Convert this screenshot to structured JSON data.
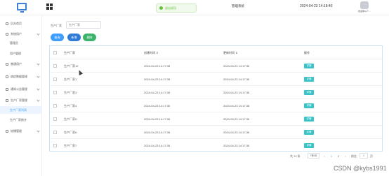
{
  "header": {
    "toast": "退出成功",
    "title": "管理系统",
    "datetime": "2024-04-23 14:18:40",
    "user_label": "欢迎你Cy⊤..."
  },
  "sidebar": {
    "items": [
      {
        "label": "后台首页",
        "has_children": false
      },
      {
        "label": "系统用户",
        "has_children": true
      },
      {
        "label": "普通用户",
        "has_children": true
      },
      {
        "label": "病症数据管理",
        "has_children": true
      },
      {
        "label": "通知公告管理",
        "has_children": true
      },
      {
        "label": "生产厂家管理",
        "has_children": true
      },
      {
        "label": "轮播管理",
        "has_children": true
      }
    ],
    "subitems": [
      "管理员",
      "用户管理",
      "生产厂家列表",
      "生产厂家统计"
    ]
  },
  "search": {
    "label": "生产厂家",
    "placeholder": "生产厂家"
  },
  "buttons": {
    "query": "查询",
    "add": "新增",
    "delete": "删除"
  },
  "table": {
    "columns": [
      "生产厂家",
      "创建时间 ⇕",
      "更新时间 ⇕",
      "操作"
    ],
    "rows": [
      {
        "name": "生产厂家12",
        "created": "2024-04-23 14:17:35",
        "updated": "2024-04-23 14:17:35",
        "action": "详情"
      },
      {
        "name": "生产厂家1",
        "created": "2024-04-23 14:17:35",
        "updated": "2024-04-23 14:17:35",
        "action": "详情"
      },
      {
        "name": "生产厂家3",
        "created": "2024-04-23 14:17:35",
        "updated": "2024-04-23 14:17:35",
        "action": "详情"
      },
      {
        "name": "生产厂家4",
        "created": "2024-04-23 14:17:35",
        "updated": "2024-04-23 14:17:35",
        "action": "详情"
      },
      {
        "name": "生产厂家5",
        "created": "2024-04-23 14:17:35",
        "updated": "2024-04-23 14:17:35",
        "action": "详情"
      },
      {
        "name": "生产厂家6",
        "created": "2024-04-23 14:17:35",
        "updated": "2024-04-23 14:17:35",
        "action": "详情"
      },
      {
        "name": "生产厂家7",
        "created": "2024-04-23 14:17:35",
        "updated": "2024-04-23 14:17:35",
        "action": "详情"
      }
    ]
  },
  "pagination": {
    "total": "共 12 条",
    "page_size": "7条/页",
    "prev": "‹",
    "pages": [
      "1",
      "2"
    ],
    "next": "›",
    "goto_label": "前往",
    "goto_value": "1",
    "goto_suffix": "页"
  },
  "watermark": "CSDN @kybs1991",
  "colors": {
    "primary": "#409eff",
    "success": "#3bb36b",
    "detail": "#3ac4c9",
    "toast_bg": "#f0f9eb"
  }
}
